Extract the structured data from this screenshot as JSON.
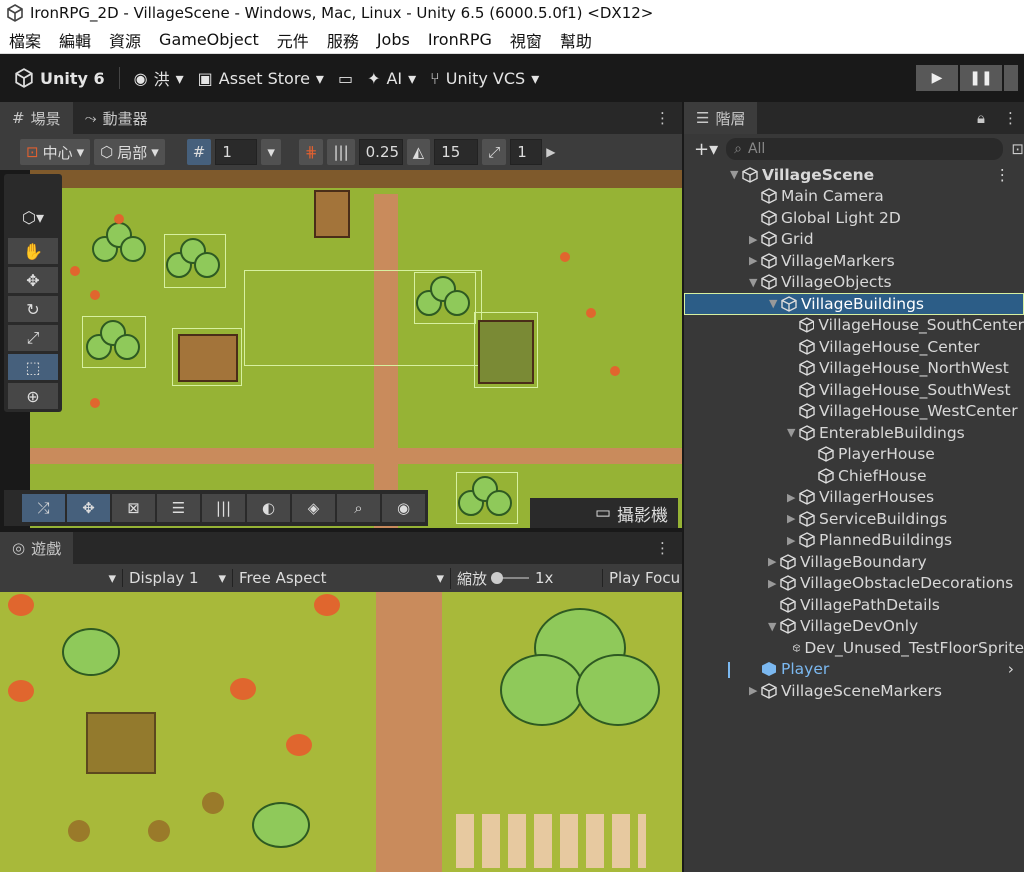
{
  "window": {
    "title": "IronRPG_2D - VillageScene - Windows, Mac, Linux - Unity 6.5 (6000.5.0f1) <DX12>"
  },
  "menu": [
    "檔案",
    "編輯",
    "資源",
    "GameObject",
    "元件",
    "服務",
    "Jobs",
    "IronRPG",
    "視窗",
    "幫助"
  ],
  "toolbar": {
    "unity_label": "Unity 6",
    "account_label": "洪",
    "asset_store_label": "Asset Store",
    "ai_label": "AI",
    "vcs_label": "Unity VCS"
  },
  "scene": {
    "tab_scene": "場景",
    "tab_animator": "動畫器",
    "pivot_label": "中心",
    "space_label": "局部",
    "grid_value": "1",
    "snap_value": "0.25",
    "rotate_value": "15",
    "scale_value": "1",
    "camera_label": "攝影機"
  },
  "game": {
    "tab_label": "遊戲",
    "display_label": "Display 1",
    "aspect_label": "Free Aspect",
    "scale_label": "縮放",
    "scale_value": "1x",
    "play_focus_label": "Play Focu"
  },
  "hierarchy": {
    "tab_label": "階層",
    "search_placeholder": "All",
    "rows": [
      {
        "label": "VillageScene",
        "indent": 0,
        "arrow": "down",
        "scene": true
      },
      {
        "label": "Main Camera",
        "indent": 1,
        "arrow": ""
      },
      {
        "label": "Global Light 2D",
        "indent": 1,
        "arrow": ""
      },
      {
        "label": "Grid",
        "indent": 1,
        "arrow": "right"
      },
      {
        "label": "VillageMarkers",
        "indent": 1,
        "arrow": "right"
      },
      {
        "label": "VillageObjects",
        "indent": 1,
        "arrow": "down"
      },
      {
        "label": "VillageBuildings",
        "indent": 2,
        "arrow": "down",
        "selected": true
      },
      {
        "label": "VillageHouse_SouthCenter",
        "indent": 3,
        "arrow": ""
      },
      {
        "label": "VillageHouse_Center",
        "indent": 3,
        "arrow": ""
      },
      {
        "label": "VillageHouse_NorthWest",
        "indent": 3,
        "arrow": ""
      },
      {
        "label": "VillageHouse_SouthWest",
        "indent": 3,
        "arrow": ""
      },
      {
        "label": "VillageHouse_WestCenter",
        "indent": 3,
        "arrow": ""
      },
      {
        "label": "EnterableBuildings",
        "indent": 3,
        "arrow": "down"
      },
      {
        "label": "PlayerHouse",
        "indent": 4,
        "arrow": ""
      },
      {
        "label": "ChiefHouse",
        "indent": 4,
        "arrow": ""
      },
      {
        "label": "VillagerHouses",
        "indent": 3,
        "arrow": "right"
      },
      {
        "label": "ServiceBuildings",
        "indent": 3,
        "arrow": "right"
      },
      {
        "label": "PlannedBuildings",
        "indent": 3,
        "arrow": "right"
      },
      {
        "label": "VillageBoundary",
        "indent": 2,
        "arrow": "right"
      },
      {
        "label": "VillageObstacleDecorations",
        "indent": 2,
        "arrow": "right"
      },
      {
        "label": "VillagePathDetails",
        "indent": 2,
        "arrow": ""
      },
      {
        "label": "VillageDevOnly",
        "indent": 2,
        "arrow": "down"
      },
      {
        "label": "Dev_Unused_TestFloorSprite",
        "indent": 3,
        "arrow": ""
      },
      {
        "label": "Player",
        "indent": 1,
        "arrow": "",
        "prefab": true
      },
      {
        "label": "VillageSceneMarkers",
        "indent": 1,
        "arrow": "right"
      }
    ]
  },
  "colors": {
    "selection": "#2c5d87",
    "prefab": "#7bb8f0",
    "grass": "#96b335",
    "road": "#c98b5c"
  }
}
